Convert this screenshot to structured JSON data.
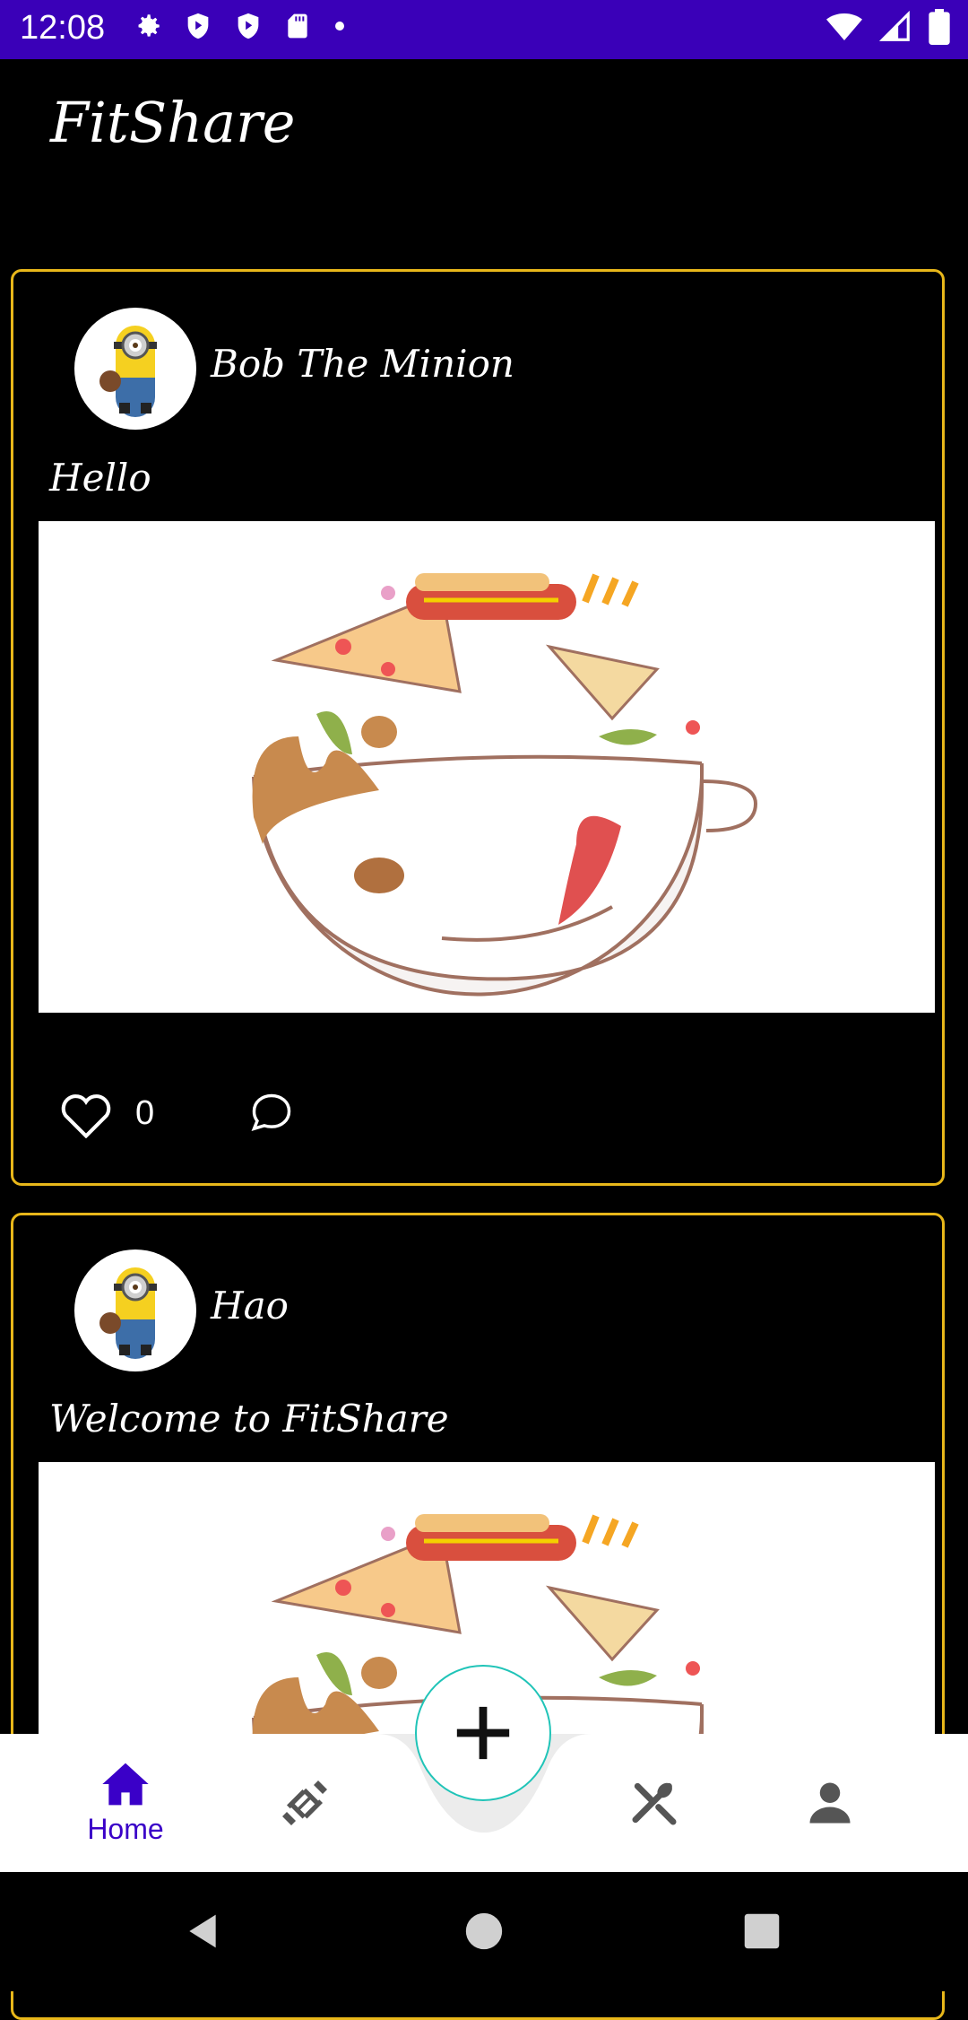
{
  "status": {
    "time": "12:08"
  },
  "app": {
    "title": "FitShare"
  },
  "posts": [
    {
      "author": "Bob The Minion",
      "caption": "Hello",
      "likes": "0"
    },
    {
      "author": "Hao",
      "caption": "Welcome to FitShare"
    }
  ],
  "nav": {
    "home_label": "Home",
    "items": [
      "home-icon",
      "dumbbell-icon",
      "plus-icon",
      "fork-knife-icon",
      "person-icon"
    ]
  },
  "colors": {
    "accent": "#3a00c8",
    "status_bar": "#3a00b8",
    "card_border": "#e8b71a",
    "fab_border": "#20c4b8"
  }
}
